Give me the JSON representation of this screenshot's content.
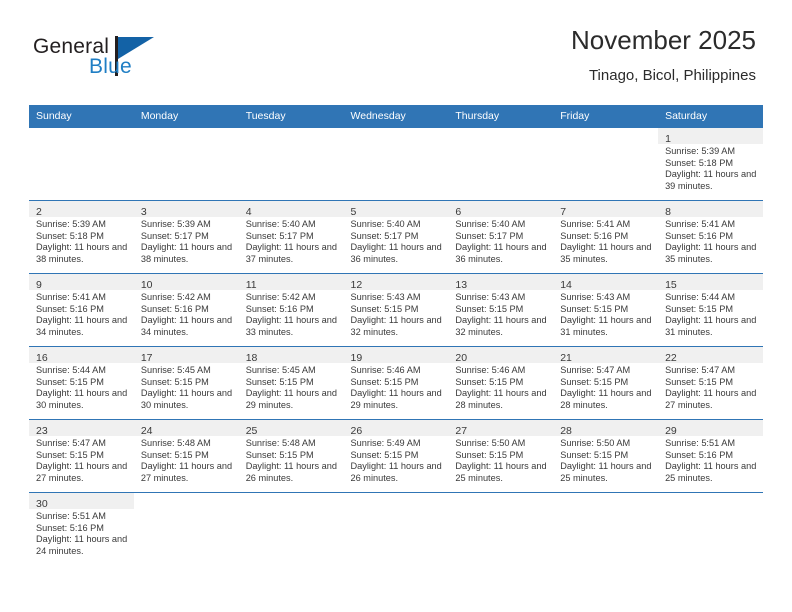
{
  "brand": {
    "name_top": "General",
    "name_bottom": "Blue",
    "color_primary": "#1362a6",
    "color_accent": "#1f7ec4"
  },
  "header": {
    "title": "November 2025",
    "subtitle": "Tinago, Bicol, Philippines"
  },
  "calendar": {
    "header_bg": "#3075b5",
    "weekday_headers": [
      "Sunday",
      "Monday",
      "Tuesday",
      "Wednesday",
      "Thursday",
      "Friday",
      "Saturday"
    ],
    "weeks": [
      [
        {
          "empty": true
        },
        {
          "empty": true
        },
        {
          "empty": true
        },
        {
          "empty": true
        },
        {
          "empty": true
        },
        {
          "empty": true
        },
        {
          "day": "1",
          "sunrise": "Sunrise: 5:39 AM",
          "sunset": "Sunset: 5:18 PM",
          "daylight": "Daylight: 11 hours and 39 minutes."
        }
      ],
      [
        {
          "day": "2",
          "sunrise": "Sunrise: 5:39 AM",
          "sunset": "Sunset: 5:18 PM",
          "daylight": "Daylight: 11 hours and 38 minutes."
        },
        {
          "day": "3",
          "sunrise": "Sunrise: 5:39 AM",
          "sunset": "Sunset: 5:17 PM",
          "daylight": "Daylight: 11 hours and 38 minutes."
        },
        {
          "day": "4",
          "sunrise": "Sunrise: 5:40 AM",
          "sunset": "Sunset: 5:17 PM",
          "daylight": "Daylight: 11 hours and 37 minutes."
        },
        {
          "day": "5",
          "sunrise": "Sunrise: 5:40 AM",
          "sunset": "Sunset: 5:17 PM",
          "daylight": "Daylight: 11 hours and 36 minutes."
        },
        {
          "day": "6",
          "sunrise": "Sunrise: 5:40 AM",
          "sunset": "Sunset: 5:17 PM",
          "daylight": "Daylight: 11 hours and 36 minutes."
        },
        {
          "day": "7",
          "sunrise": "Sunrise: 5:41 AM",
          "sunset": "Sunset: 5:16 PM",
          "daylight": "Daylight: 11 hours and 35 minutes."
        },
        {
          "day": "8",
          "sunrise": "Sunrise: 5:41 AM",
          "sunset": "Sunset: 5:16 PM",
          "daylight": "Daylight: 11 hours and 35 minutes."
        }
      ],
      [
        {
          "day": "9",
          "sunrise": "Sunrise: 5:41 AM",
          "sunset": "Sunset: 5:16 PM",
          "daylight": "Daylight: 11 hours and 34 minutes."
        },
        {
          "day": "10",
          "sunrise": "Sunrise: 5:42 AM",
          "sunset": "Sunset: 5:16 PM",
          "daylight": "Daylight: 11 hours and 34 minutes."
        },
        {
          "day": "11",
          "sunrise": "Sunrise: 5:42 AM",
          "sunset": "Sunset: 5:16 PM",
          "daylight": "Daylight: 11 hours and 33 minutes."
        },
        {
          "day": "12",
          "sunrise": "Sunrise: 5:43 AM",
          "sunset": "Sunset: 5:15 PM",
          "daylight": "Daylight: 11 hours and 32 minutes."
        },
        {
          "day": "13",
          "sunrise": "Sunrise: 5:43 AM",
          "sunset": "Sunset: 5:15 PM",
          "daylight": "Daylight: 11 hours and 32 minutes."
        },
        {
          "day": "14",
          "sunrise": "Sunrise: 5:43 AM",
          "sunset": "Sunset: 5:15 PM",
          "daylight": "Daylight: 11 hours and 31 minutes."
        },
        {
          "day": "15",
          "sunrise": "Sunrise: 5:44 AM",
          "sunset": "Sunset: 5:15 PM",
          "daylight": "Daylight: 11 hours and 31 minutes."
        }
      ],
      [
        {
          "day": "16",
          "sunrise": "Sunrise: 5:44 AM",
          "sunset": "Sunset: 5:15 PM",
          "daylight": "Daylight: 11 hours and 30 minutes."
        },
        {
          "day": "17",
          "sunrise": "Sunrise: 5:45 AM",
          "sunset": "Sunset: 5:15 PM",
          "daylight": "Daylight: 11 hours and 30 minutes."
        },
        {
          "day": "18",
          "sunrise": "Sunrise: 5:45 AM",
          "sunset": "Sunset: 5:15 PM",
          "daylight": "Daylight: 11 hours and 29 minutes."
        },
        {
          "day": "19",
          "sunrise": "Sunrise: 5:46 AM",
          "sunset": "Sunset: 5:15 PM",
          "daylight": "Daylight: 11 hours and 29 minutes."
        },
        {
          "day": "20",
          "sunrise": "Sunrise: 5:46 AM",
          "sunset": "Sunset: 5:15 PM",
          "daylight": "Daylight: 11 hours and 28 minutes."
        },
        {
          "day": "21",
          "sunrise": "Sunrise: 5:47 AM",
          "sunset": "Sunset: 5:15 PM",
          "daylight": "Daylight: 11 hours and 28 minutes."
        },
        {
          "day": "22",
          "sunrise": "Sunrise: 5:47 AM",
          "sunset": "Sunset: 5:15 PM",
          "daylight": "Daylight: 11 hours and 27 minutes."
        }
      ],
      [
        {
          "day": "23",
          "sunrise": "Sunrise: 5:47 AM",
          "sunset": "Sunset: 5:15 PM",
          "daylight": "Daylight: 11 hours and 27 minutes."
        },
        {
          "day": "24",
          "sunrise": "Sunrise: 5:48 AM",
          "sunset": "Sunset: 5:15 PM",
          "daylight": "Daylight: 11 hours and 27 minutes."
        },
        {
          "day": "25",
          "sunrise": "Sunrise: 5:48 AM",
          "sunset": "Sunset: 5:15 PM",
          "daylight": "Daylight: 11 hours and 26 minutes."
        },
        {
          "day": "26",
          "sunrise": "Sunrise: 5:49 AM",
          "sunset": "Sunset: 5:15 PM",
          "daylight": "Daylight: 11 hours and 26 minutes."
        },
        {
          "day": "27",
          "sunrise": "Sunrise: 5:50 AM",
          "sunset": "Sunset: 5:15 PM",
          "daylight": "Daylight: 11 hours and 25 minutes."
        },
        {
          "day": "28",
          "sunrise": "Sunrise: 5:50 AM",
          "sunset": "Sunset: 5:15 PM",
          "daylight": "Daylight: 11 hours and 25 minutes."
        },
        {
          "day": "29",
          "sunrise": "Sunrise: 5:51 AM",
          "sunset": "Sunset: 5:16 PM",
          "daylight": "Daylight: 11 hours and 25 minutes."
        }
      ],
      [
        {
          "day": "30",
          "sunrise": "Sunrise: 5:51 AM",
          "sunset": "Sunset: 5:16 PM",
          "daylight": "Daylight: 11 hours and 24 minutes."
        },
        {
          "empty": true
        },
        {
          "empty": true
        },
        {
          "empty": true
        },
        {
          "empty": true
        },
        {
          "empty": true
        },
        {
          "empty": true
        }
      ]
    ]
  }
}
